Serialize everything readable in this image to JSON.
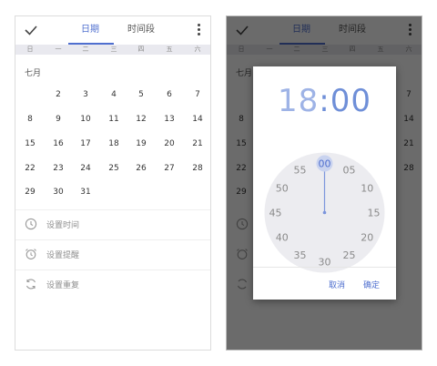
{
  "tabs": {
    "date": "日期",
    "time_range": "时间段"
  },
  "weekdays": [
    "日",
    "一",
    "二",
    "三",
    "四",
    "五",
    "六"
  ],
  "month_label": "七月",
  "days": [
    1,
    2,
    3,
    4,
    5,
    6,
    7,
    8,
    9,
    10,
    11,
    12,
    13,
    14,
    15,
    16,
    17,
    18,
    19,
    20,
    21,
    22,
    23,
    24,
    25,
    26,
    27,
    28,
    29,
    30,
    31
  ],
  "selected_day": 1,
  "options": [
    {
      "label": "设置时间",
      "icon": "clock-icon"
    },
    {
      "label": "设置提醒",
      "icon": "alarm-icon"
    },
    {
      "label": "设置重复",
      "icon": "repeat-icon"
    }
  ],
  "dialog": {
    "hour": "18",
    "separator": ":",
    "minute": "00",
    "clock_numbers": [
      "00",
      "05",
      "10",
      "15",
      "20",
      "25",
      "30",
      "35",
      "40",
      "45",
      "50",
      "55"
    ],
    "selected_minute": "00",
    "cancel_label": "取消",
    "ok_label": "确定"
  },
  "colors": {
    "accent": "#4f6fcf",
    "selected_fill": "#6183dc",
    "clock_face": "#ececf0"
  }
}
